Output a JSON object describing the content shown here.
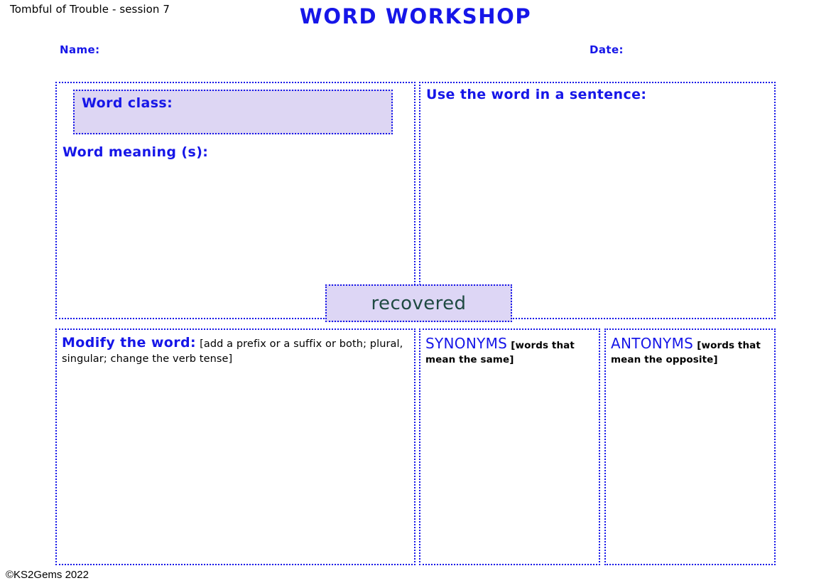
{
  "header": {
    "session": "Tombful of Trouble - session 7",
    "title": "WORD WORKSHOP",
    "name_label": "Name:",
    "date_label": "Date:"
  },
  "focus_word": "recovered",
  "panels": {
    "word_class": {
      "heading": "Word class:"
    },
    "word_meaning": {
      "heading": "Word meaning (s):"
    },
    "sentence": {
      "heading": "Use the word in a sentence:"
    },
    "modify": {
      "heading": "Modify the word:",
      "note": "[add a prefix or a suffix or both; plural, singular; change the verb tense]"
    },
    "synonyms": {
      "heading": "SYNONYMS",
      "note": "[words that mean the same]"
    },
    "antonyms": {
      "heading": "ANTONYMS",
      "note": "[words that mean the opposite]"
    }
  },
  "footer": {
    "copyright": "©KS2Gems 2022"
  },
  "colors": {
    "accent_blue": "#1616e8",
    "panel_fill": "#ddd6f3",
    "focus_word_text": "#1f4a42"
  }
}
